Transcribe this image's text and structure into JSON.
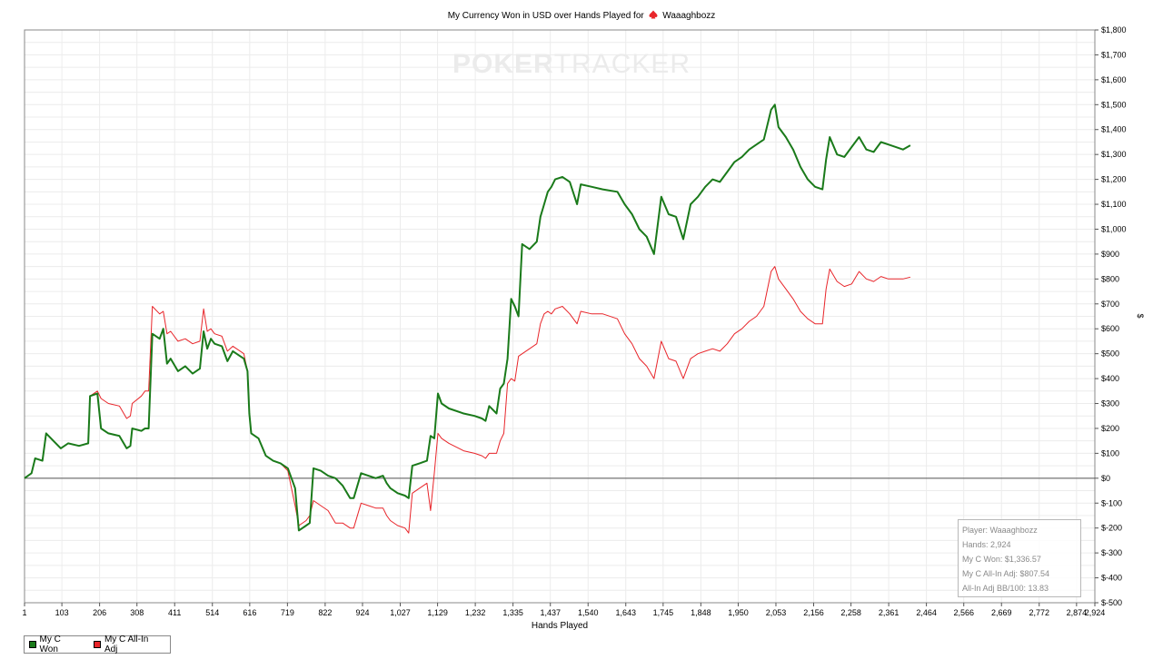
{
  "chart_data": {
    "type": "line",
    "title": "My Currency Won in USD over Hands Played for",
    "player_name": "Waaaghbozz",
    "xlabel": "Hands Played",
    "ylabel": "$",
    "xlim": [
      1,
      2924
    ],
    "ylim": [
      -500,
      1800
    ],
    "x_ticks": [
      "1",
      "103",
      "206",
      "308",
      "411",
      "514",
      "616",
      "719",
      "822",
      "924",
      "1,027",
      "1,129",
      "1,232",
      "1,335",
      "1,437",
      "1,540",
      "1,643",
      "1,745",
      "1,848",
      "1,950",
      "2,053",
      "2,156",
      "2,258",
      "2,361",
      "2,464",
      "2,566",
      "2,669",
      "2,772",
      "2,874",
      "2,924"
    ],
    "x_tick_values": [
      1,
      103,
      206,
      308,
      411,
      514,
      616,
      719,
      822,
      924,
      1027,
      1129,
      1232,
      1335,
      1437,
      1540,
      1643,
      1745,
      1848,
      1950,
      2053,
      2156,
      2258,
      2361,
      2464,
      2566,
      2669,
      2772,
      2874,
      2924
    ],
    "y_ticks": [
      "$1,800",
      "$1,700",
      "$1,600",
      "$1,500",
      "$1,400",
      "$1,300",
      "$1,200",
      "$1,100",
      "$1,000",
      "$900",
      "$800",
      "$700",
      "$600",
      "$500",
      "$400",
      "$300",
      "$200",
      "$100",
      "$0",
      "$-100",
      "$-200",
      "$-300",
      "$-400",
      "$-500"
    ],
    "y_tick_values": [
      1800,
      1700,
      1600,
      1500,
      1400,
      1300,
      1200,
      1100,
      1000,
      900,
      800,
      700,
      600,
      500,
      400,
      300,
      200,
      100,
      0,
      -100,
      -200,
      -300,
      -400,
      -500
    ],
    "grid": true,
    "legend_position": "bottom-left",
    "series": [
      {
        "name": "My C Won",
        "color": "#1a7a1a",
        "points": [
          [
            1,
            0
          ],
          [
            20,
            20
          ],
          [
            30,
            80
          ],
          [
            50,
            70
          ],
          [
            60,
            180
          ],
          [
            80,
            150
          ],
          [
            100,
            120
          ],
          [
            120,
            140
          ],
          [
            150,
            130
          ],
          [
            175,
            140
          ],
          [
            180,
            330
          ],
          [
            200,
            340
          ],
          [
            210,
            200
          ],
          [
            230,
            180
          ],
          [
            260,
            170
          ],
          [
            280,
            120
          ],
          [
            290,
            130
          ],
          [
            295,
            200
          ],
          [
            320,
            190
          ],
          [
            330,
            200
          ],
          [
            340,
            200
          ],
          [
            350,
            580
          ],
          [
            370,
            560
          ],
          [
            380,
            600
          ],
          [
            390,
            460
          ],
          [
            400,
            480
          ],
          [
            420,
            430
          ],
          [
            440,
            450
          ],
          [
            460,
            420
          ],
          [
            480,
            440
          ],
          [
            490,
            590
          ],
          [
            500,
            520
          ],
          [
            510,
            560
          ],
          [
            520,
            540
          ],
          [
            540,
            530
          ],
          [
            555,
            470
          ],
          [
            570,
            510
          ],
          [
            590,
            490
          ],
          [
            600,
            480
          ],
          [
            610,
            430
          ],
          [
            615,
            260
          ],
          [
            620,
            180
          ],
          [
            640,
            160
          ],
          [
            660,
            90
          ],
          [
            680,
            70
          ],
          [
            700,
            60
          ],
          [
            720,
            40
          ],
          [
            740,
            -40
          ],
          [
            750,
            -210
          ],
          [
            770,
            -190
          ],
          [
            780,
            -180
          ],
          [
            790,
            40
          ],
          [
            810,
            30
          ],
          [
            830,
            10
          ],
          [
            850,
            0
          ],
          [
            870,
            -30
          ],
          [
            890,
            -80
          ],
          [
            900,
            -80
          ],
          [
            920,
            20
          ],
          [
            940,
            10
          ],
          [
            960,
            0
          ],
          [
            980,
            10
          ],
          [
            990,
            -20
          ],
          [
            1000,
            -40
          ],
          [
            1020,
            -60
          ],
          [
            1040,
            -70
          ],
          [
            1050,
            -80
          ],
          [
            1060,
            50
          ],
          [
            1080,
            60
          ],
          [
            1100,
            70
          ],
          [
            1110,
            170
          ],
          [
            1120,
            160
          ],
          [
            1130,
            340
          ],
          [
            1140,
            300
          ],
          [
            1160,
            280
          ],
          [
            1200,
            260
          ],
          [
            1230,
            250
          ],
          [
            1250,
            240
          ],
          [
            1260,
            230
          ],
          [
            1270,
            290
          ],
          [
            1290,
            260
          ],
          [
            1300,
            360
          ],
          [
            1310,
            380
          ],
          [
            1320,
            480
          ],
          [
            1330,
            720
          ],
          [
            1340,
            690
          ],
          [
            1350,
            650
          ],
          [
            1360,
            940
          ],
          [
            1380,
            920
          ],
          [
            1400,
            950
          ],
          [
            1410,
            1050
          ],
          [
            1420,
            1100
          ],
          [
            1430,
            1150
          ],
          [
            1440,
            1170
          ],
          [
            1450,
            1200
          ],
          [
            1470,
            1210
          ],
          [
            1490,
            1190
          ],
          [
            1510,
            1100
          ],
          [
            1520,
            1180
          ],
          [
            1550,
            1170
          ],
          [
            1580,
            1160
          ],
          [
            1620,
            1150
          ],
          [
            1640,
            1100
          ],
          [
            1660,
            1060
          ],
          [
            1680,
            1000
          ],
          [
            1700,
            970
          ],
          [
            1720,
            900
          ],
          [
            1740,
            1130
          ],
          [
            1760,
            1060
          ],
          [
            1780,
            1050
          ],
          [
            1800,
            960
          ],
          [
            1820,
            1100
          ],
          [
            1840,
            1130
          ],
          [
            1860,
            1170
          ],
          [
            1880,
            1200
          ],
          [
            1900,
            1190
          ],
          [
            1920,
            1230
          ],
          [
            1940,
            1270
          ],
          [
            1960,
            1290
          ],
          [
            1980,
            1320
          ],
          [
            2000,
            1340
          ],
          [
            2020,
            1360
          ],
          [
            2040,
            1480
          ],
          [
            2050,
            1500
          ],
          [
            2060,
            1410
          ],
          [
            2080,
            1370
          ],
          [
            2100,
            1320
          ],
          [
            2120,
            1250
          ],
          [
            2140,
            1200
          ],
          [
            2160,
            1170
          ],
          [
            2180,
            1160
          ],
          [
            2190,
            1280
          ],
          [
            2200,
            1370
          ],
          [
            2220,
            1300
          ],
          [
            2240,
            1290
          ],
          [
            2260,
            1330
          ],
          [
            2280,
            1370
          ],
          [
            2300,
            1320
          ],
          [
            2320,
            1310
          ],
          [
            2340,
            1350
          ],
          [
            2360,
            1340
          ],
          [
            2380,
            1330
          ],
          [
            2400,
            1320
          ],
          [
            2420,
            1336.57
          ]
        ]
      },
      {
        "name": "My C All-In Adj",
        "color": "#e8252a",
        "points": [
          [
            1,
            0
          ],
          [
            20,
            20
          ],
          [
            30,
            80
          ],
          [
            50,
            70
          ],
          [
            60,
            180
          ],
          [
            80,
            150
          ],
          [
            100,
            120
          ],
          [
            120,
            140
          ],
          [
            150,
            130
          ],
          [
            175,
            140
          ],
          [
            180,
            330
          ],
          [
            200,
            350
          ],
          [
            210,
            320
          ],
          [
            230,
            300
          ],
          [
            260,
            290
          ],
          [
            280,
            240
          ],
          [
            290,
            250
          ],
          [
            295,
            300
          ],
          [
            320,
            330
          ],
          [
            330,
            350
          ],
          [
            340,
            350
          ],
          [
            350,
            690
          ],
          [
            370,
            660
          ],
          [
            380,
            670
          ],
          [
            390,
            580
          ],
          [
            400,
            590
          ],
          [
            420,
            550
          ],
          [
            440,
            560
          ],
          [
            460,
            540
          ],
          [
            480,
            550
          ],
          [
            490,
            680
          ],
          [
            500,
            590
          ],
          [
            510,
            600
          ],
          [
            520,
            580
          ],
          [
            540,
            570
          ],
          [
            555,
            510
          ],
          [
            570,
            530
          ],
          [
            590,
            510
          ],
          [
            600,
            500
          ],
          [
            610,
            430
          ],
          [
            615,
            260
          ],
          [
            620,
            180
          ],
          [
            640,
            160
          ],
          [
            660,
            90
          ],
          [
            680,
            70
          ],
          [
            700,
            60
          ],
          [
            720,
            30
          ],
          [
            740,
            -110
          ],
          [
            750,
            -190
          ],
          [
            770,
            -170
          ],
          [
            780,
            -150
          ],
          [
            790,
            -90
          ],
          [
            810,
            -110
          ],
          [
            830,
            -130
          ],
          [
            850,
            -180
          ],
          [
            870,
            -180
          ],
          [
            890,
            -200
          ],
          [
            900,
            -200
          ],
          [
            920,
            -100
          ],
          [
            940,
            -110
          ],
          [
            960,
            -120
          ],
          [
            980,
            -120
          ],
          [
            990,
            -150
          ],
          [
            1000,
            -170
          ],
          [
            1020,
            -190
          ],
          [
            1040,
            -200
          ],
          [
            1050,
            -220
          ],
          [
            1060,
            -60
          ],
          [
            1080,
            -40
          ],
          [
            1100,
            -20
          ],
          [
            1110,
            -130
          ],
          [
            1120,
            20
          ],
          [
            1130,
            180
          ],
          [
            1140,
            160
          ],
          [
            1160,
            140
          ],
          [
            1200,
            110
          ],
          [
            1230,
            100
          ],
          [
            1250,
            90
          ],
          [
            1260,
            80
          ],
          [
            1270,
            100
          ],
          [
            1290,
            100
          ],
          [
            1300,
            150
          ],
          [
            1310,
            180
          ],
          [
            1320,
            380
          ],
          [
            1330,
            400
          ],
          [
            1340,
            390
          ],
          [
            1350,
            490
          ],
          [
            1380,
            520
          ],
          [
            1400,
            540
          ],
          [
            1410,
            620
          ],
          [
            1420,
            660
          ],
          [
            1430,
            670
          ],
          [
            1440,
            660
          ],
          [
            1450,
            680
          ],
          [
            1470,
            690
          ],
          [
            1490,
            660
          ],
          [
            1510,
            620
          ],
          [
            1520,
            670
          ],
          [
            1550,
            660
          ],
          [
            1580,
            660
          ],
          [
            1620,
            640
          ],
          [
            1640,
            580
          ],
          [
            1660,
            540
          ],
          [
            1680,
            480
          ],
          [
            1700,
            450
          ],
          [
            1720,
            400
          ],
          [
            1740,
            550
          ],
          [
            1760,
            480
          ],
          [
            1780,
            470
          ],
          [
            1800,
            400
          ],
          [
            1820,
            480
          ],
          [
            1840,
            500
          ],
          [
            1860,
            510
          ],
          [
            1880,
            520
          ],
          [
            1900,
            510
          ],
          [
            1920,
            540
          ],
          [
            1940,
            580
          ],
          [
            1960,
            600
          ],
          [
            1980,
            630
          ],
          [
            2000,
            650
          ],
          [
            2020,
            690
          ],
          [
            2040,
            830
          ],
          [
            2050,
            850
          ],
          [
            2060,
            800
          ],
          [
            2080,
            760
          ],
          [
            2100,
            720
          ],
          [
            2120,
            670
          ],
          [
            2140,
            640
          ],
          [
            2160,
            620
          ],
          [
            2180,
            620
          ],
          [
            2190,
            760
          ],
          [
            2200,
            840
          ],
          [
            2220,
            790
          ],
          [
            2240,
            770
          ],
          [
            2260,
            780
          ],
          [
            2280,
            830
          ],
          [
            2300,
            800
          ],
          [
            2320,
            790
          ],
          [
            2340,
            810
          ],
          [
            2360,
            800
          ],
          [
            2380,
            800
          ],
          [
            2400,
            800
          ],
          [
            2420,
            807.54
          ]
        ]
      }
    ]
  },
  "stats": {
    "player": "Player: Waaaghbozz",
    "hands": "Hands: 2,924",
    "won": "My C Won: $1,336.57",
    "adj": "My C All-In Adj: $807.54",
    "bb100": "All-In Adj BB/100: 13.83"
  },
  "logo": {
    "part1": "POKER",
    "part2": "TRACKER"
  },
  "colors": {
    "won": "#1a7a1a",
    "adj": "#e8252a",
    "suit": "#e8252a"
  }
}
